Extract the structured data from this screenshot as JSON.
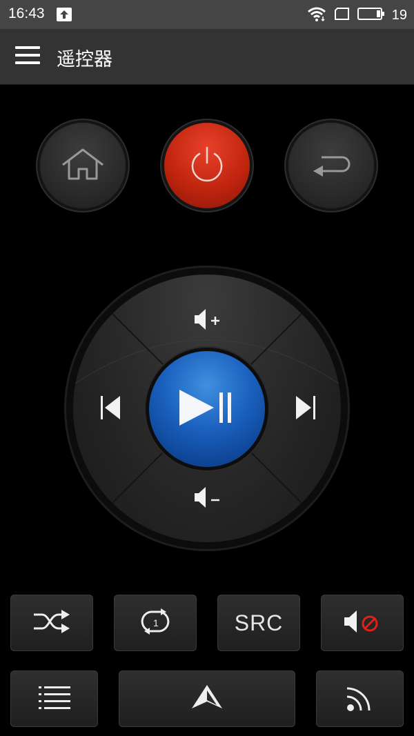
{
  "status_bar": {
    "time": "16:43",
    "battery_level": "19",
    "icons": [
      "upload-icon",
      "wifi-icon",
      "screen-icon",
      "battery-icon"
    ]
  },
  "app_bar": {
    "title": "遥控器",
    "menu_icon": "menu-icon"
  },
  "top_buttons": [
    {
      "name": "home",
      "icon": "home-icon"
    },
    {
      "name": "power",
      "icon": "power-icon",
      "color": "#d0301a"
    },
    {
      "name": "back",
      "icon": "back-arrow-icon"
    }
  ],
  "dpad": {
    "up": "volume-up-icon",
    "down": "volume-down-icon",
    "left": "previous-track-icon",
    "right": "next-track-icon",
    "center": "play-pause-icon",
    "center_color": "#1a60bd"
  },
  "row1": [
    {
      "name": "shuffle",
      "icon": "shuffle-icon"
    },
    {
      "name": "repeat-one",
      "icon": "repeat-one-icon",
      "badge": "1"
    },
    {
      "name": "source",
      "label": "SRC"
    },
    {
      "name": "mute",
      "icon": "mute-icon",
      "accent": "#e0201a"
    }
  ],
  "row2": [
    {
      "name": "list",
      "icon": "list-icon"
    },
    {
      "name": "navigate",
      "icon": "navigation-arrow-icon"
    },
    {
      "name": "cast",
      "icon": "cast-icon"
    }
  ]
}
